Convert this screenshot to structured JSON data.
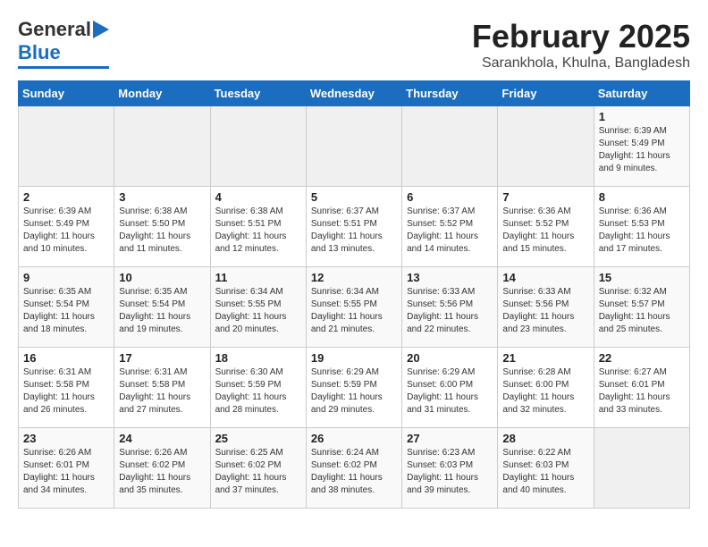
{
  "header": {
    "logo_general": "General",
    "logo_blue": "Blue",
    "month": "February 2025",
    "location": "Sarankhola, Khulna, Bangladesh"
  },
  "calendar": {
    "days_of_week": [
      "Sunday",
      "Monday",
      "Tuesday",
      "Wednesday",
      "Thursday",
      "Friday",
      "Saturday"
    ],
    "weeks": [
      [
        {
          "day": "",
          "info": ""
        },
        {
          "day": "",
          "info": ""
        },
        {
          "day": "",
          "info": ""
        },
        {
          "day": "",
          "info": ""
        },
        {
          "day": "",
          "info": ""
        },
        {
          "day": "",
          "info": ""
        },
        {
          "day": "1",
          "info": "Sunrise: 6:39 AM\nSunset: 5:49 PM\nDaylight: 11 hours and 9 minutes."
        }
      ],
      [
        {
          "day": "2",
          "info": "Sunrise: 6:39 AM\nSunset: 5:49 PM\nDaylight: 11 hours and 10 minutes."
        },
        {
          "day": "3",
          "info": "Sunrise: 6:38 AM\nSunset: 5:50 PM\nDaylight: 11 hours and 11 minutes."
        },
        {
          "day": "4",
          "info": "Sunrise: 6:38 AM\nSunset: 5:51 PM\nDaylight: 11 hours and 12 minutes."
        },
        {
          "day": "5",
          "info": "Sunrise: 6:37 AM\nSunset: 5:51 PM\nDaylight: 11 hours and 13 minutes."
        },
        {
          "day": "6",
          "info": "Sunrise: 6:37 AM\nSunset: 5:52 PM\nDaylight: 11 hours and 14 minutes."
        },
        {
          "day": "7",
          "info": "Sunrise: 6:36 AM\nSunset: 5:52 PM\nDaylight: 11 hours and 15 minutes."
        },
        {
          "day": "8",
          "info": "Sunrise: 6:36 AM\nSunset: 5:53 PM\nDaylight: 11 hours and 17 minutes."
        }
      ],
      [
        {
          "day": "9",
          "info": "Sunrise: 6:35 AM\nSunset: 5:54 PM\nDaylight: 11 hours and 18 minutes."
        },
        {
          "day": "10",
          "info": "Sunrise: 6:35 AM\nSunset: 5:54 PM\nDaylight: 11 hours and 19 minutes."
        },
        {
          "day": "11",
          "info": "Sunrise: 6:34 AM\nSunset: 5:55 PM\nDaylight: 11 hours and 20 minutes."
        },
        {
          "day": "12",
          "info": "Sunrise: 6:34 AM\nSunset: 5:55 PM\nDaylight: 11 hours and 21 minutes."
        },
        {
          "day": "13",
          "info": "Sunrise: 6:33 AM\nSunset: 5:56 PM\nDaylight: 11 hours and 22 minutes."
        },
        {
          "day": "14",
          "info": "Sunrise: 6:33 AM\nSunset: 5:56 PM\nDaylight: 11 hours and 23 minutes."
        },
        {
          "day": "15",
          "info": "Sunrise: 6:32 AM\nSunset: 5:57 PM\nDaylight: 11 hours and 25 minutes."
        }
      ],
      [
        {
          "day": "16",
          "info": "Sunrise: 6:31 AM\nSunset: 5:58 PM\nDaylight: 11 hours and 26 minutes."
        },
        {
          "day": "17",
          "info": "Sunrise: 6:31 AM\nSunset: 5:58 PM\nDaylight: 11 hours and 27 minutes."
        },
        {
          "day": "18",
          "info": "Sunrise: 6:30 AM\nSunset: 5:59 PM\nDaylight: 11 hours and 28 minutes."
        },
        {
          "day": "19",
          "info": "Sunrise: 6:29 AM\nSunset: 5:59 PM\nDaylight: 11 hours and 29 minutes."
        },
        {
          "day": "20",
          "info": "Sunrise: 6:29 AM\nSunset: 6:00 PM\nDaylight: 11 hours and 31 minutes."
        },
        {
          "day": "21",
          "info": "Sunrise: 6:28 AM\nSunset: 6:00 PM\nDaylight: 11 hours and 32 minutes."
        },
        {
          "day": "22",
          "info": "Sunrise: 6:27 AM\nSunset: 6:01 PM\nDaylight: 11 hours and 33 minutes."
        }
      ],
      [
        {
          "day": "23",
          "info": "Sunrise: 6:26 AM\nSunset: 6:01 PM\nDaylight: 11 hours and 34 minutes."
        },
        {
          "day": "24",
          "info": "Sunrise: 6:26 AM\nSunset: 6:02 PM\nDaylight: 11 hours and 35 minutes."
        },
        {
          "day": "25",
          "info": "Sunrise: 6:25 AM\nSunset: 6:02 PM\nDaylight: 11 hours and 37 minutes."
        },
        {
          "day": "26",
          "info": "Sunrise: 6:24 AM\nSunset: 6:02 PM\nDaylight: 11 hours and 38 minutes."
        },
        {
          "day": "27",
          "info": "Sunrise: 6:23 AM\nSunset: 6:03 PM\nDaylight: 11 hours and 39 minutes."
        },
        {
          "day": "28",
          "info": "Sunrise: 6:22 AM\nSunset: 6:03 PM\nDaylight: 11 hours and 40 minutes."
        },
        {
          "day": "",
          "info": ""
        }
      ]
    ]
  }
}
